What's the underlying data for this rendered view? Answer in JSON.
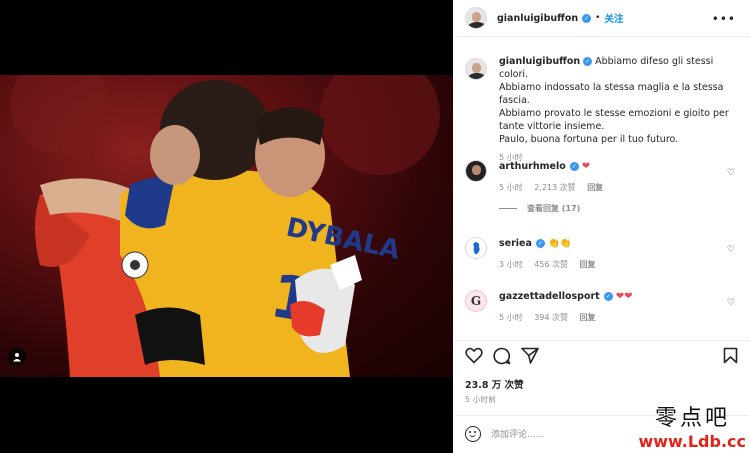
{
  "post": {
    "username": "gianluigibuffon",
    "follow_label": "关注",
    "more_label": "•••",
    "caption_lines": [
      "Abbiamo difeso gli stessi colori.",
      "Abbiamo indossato la stessa maglia e la stessa fascia.",
      "Abbiamo provato le stesse emozioni e gioito per tante vittorie insieme.",
      "Paulo, buona fortuna per il tuo futuro."
    ],
    "caption_time": "5 小时",
    "likes": "23.8 万 次赞",
    "time_ago": "5 小时前"
  },
  "photo": {
    "jersey_name": "DYBALA",
    "jersey_number": "10"
  },
  "comments": [
    {
      "username": "arthurhmelo",
      "text": "❤",
      "time": "5 小时",
      "likes": "2,213 次赞",
      "reply": "回复",
      "view_replies": "查看回复 (17)"
    },
    {
      "username": "seriea",
      "text": "👏👏",
      "time": "3 小时",
      "likes": "456 次赞",
      "reply": "回复"
    },
    {
      "username": "gazzettadellosport",
      "text": "❤❤",
      "time": "5 小时",
      "likes": "394 次赞",
      "reply": "回复"
    }
  ],
  "comment_bar": {
    "placeholder": "添加评论......"
  },
  "watermark": {
    "text": "零点吧",
    "url": "www.Ldb.cc"
  },
  "icons": [
    "heart-icon",
    "comment-icon",
    "share-icon",
    "bookmark-icon",
    "emoji-icon",
    "tag-person-icon",
    "verified-icon"
  ]
}
